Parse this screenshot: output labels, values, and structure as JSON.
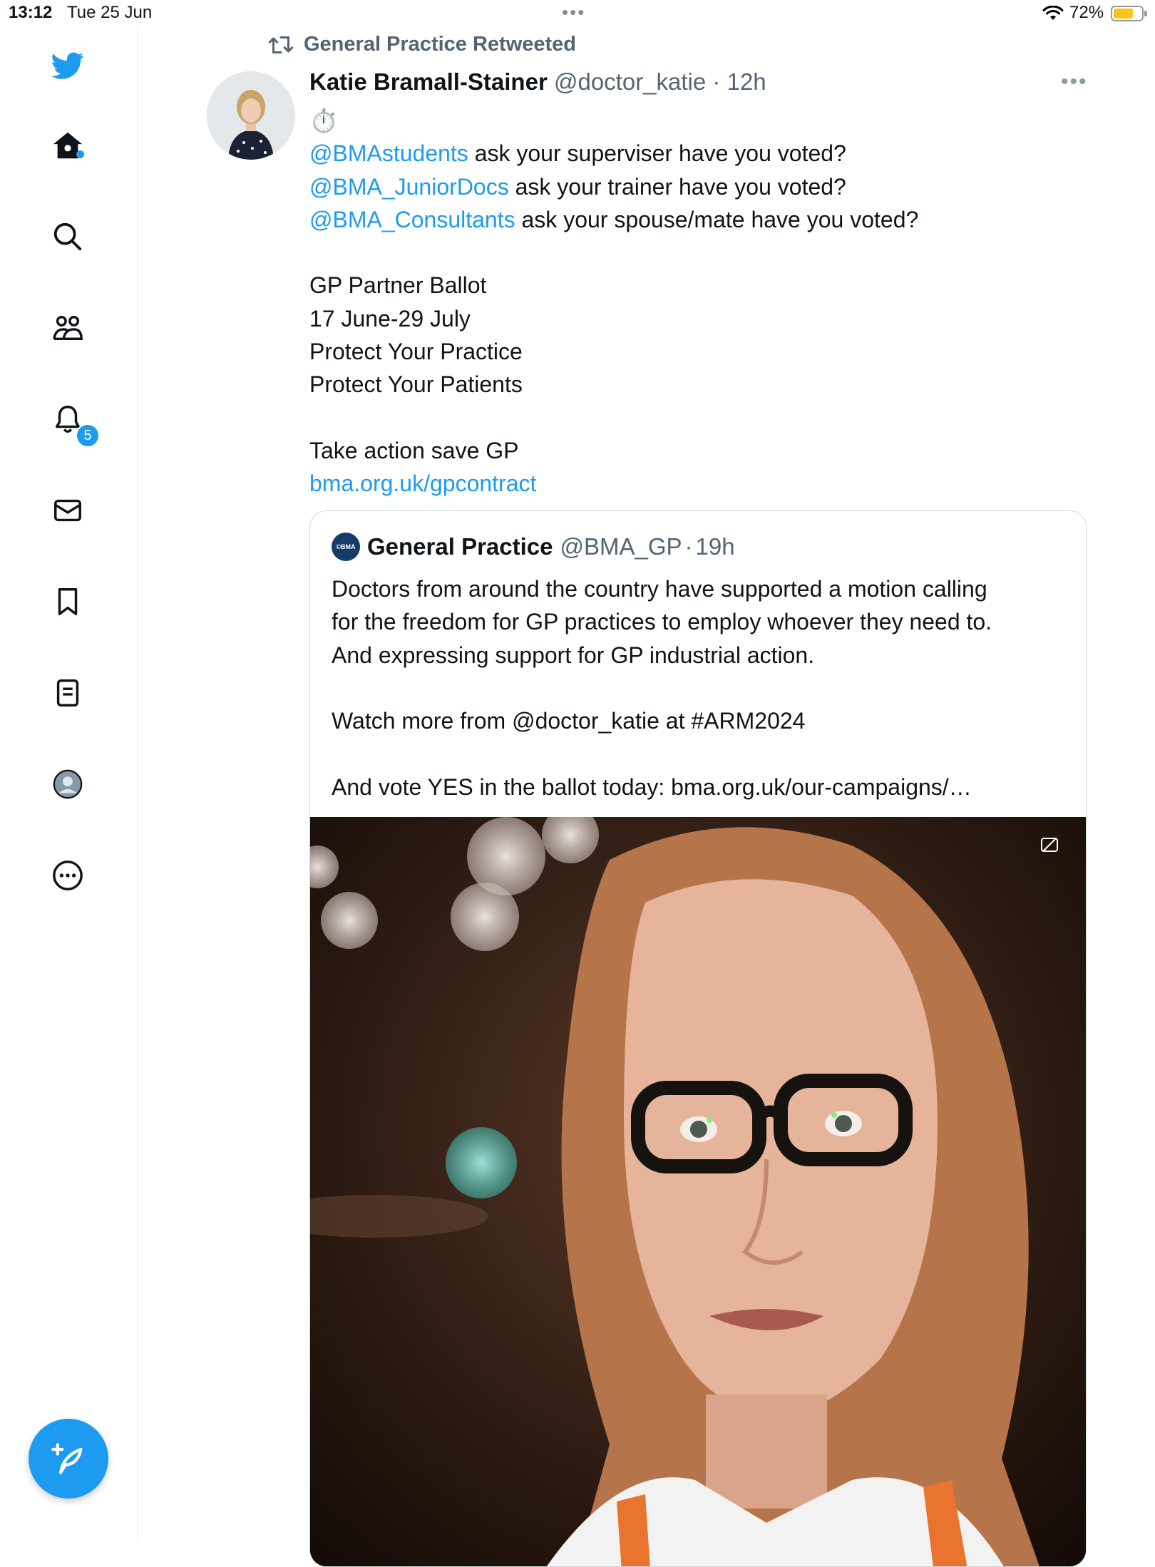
{
  "status_bar": {
    "time": "13:12",
    "date": "Tue 25 Jun",
    "battery_percent": "72%",
    "battery_level": 0.72,
    "battery_color": "#f5c518"
  },
  "sidebar": {
    "items": [
      {
        "name": "twitter-logo-icon"
      },
      {
        "name": "home-icon"
      },
      {
        "name": "search-icon"
      },
      {
        "name": "communities-icon"
      },
      {
        "name": "notifications-icon",
        "badge": "5"
      },
      {
        "name": "messages-icon"
      },
      {
        "name": "bookmarks-icon"
      },
      {
        "name": "lists-icon"
      },
      {
        "name": "profile-icon"
      },
      {
        "name": "more-icon"
      }
    ],
    "compose_icon": "compose-feather-icon",
    "accent_color": "#1d9bf0"
  },
  "tweet": {
    "retweeted_by": "General Practice Retweeted",
    "author_name": "Katie Bramall-Stainer",
    "handle": "@doctor_katie",
    "separator": "·",
    "time": "12h",
    "emoji": "⏱️",
    "mention_1": "@BMAstudents",
    "line_1_rest": " ask your superviser have you voted?",
    "mention_2": "@BMA_JuniorDocs",
    "line_2_rest": " ask your trainer have you voted?",
    "mention_3": "@BMA_Consultants",
    "line_3_rest": " ask your spouse/mate have you voted?",
    "ballot_title": "GP Partner Ballot",
    "ballot_dates": "17 June-29 July",
    "protect_practice": "Protect Your Practice",
    "protect_patients": "Protect Your Patients",
    "take_action": "Take action save GP",
    "link": "bma.org.uk/gpcontract"
  },
  "quoted_tweet": {
    "avatar_text": "©BMA",
    "author_name": "General Practice",
    "handle": "@BMA_GP",
    "separator": "·",
    "time": "19h",
    "line_1": "Doctors from around the country have supported a motion calling",
    "line_2": "for the freedom for GP practices to employ whoever they need to.",
    "line_3": "And expressing support for GP industrial action.",
    "line_4": "Watch more from @doctor_katie at #ARM2024",
    "line_5": "And vote YES in the ballot today: bma.org.uk/our-campaigns/…"
  }
}
